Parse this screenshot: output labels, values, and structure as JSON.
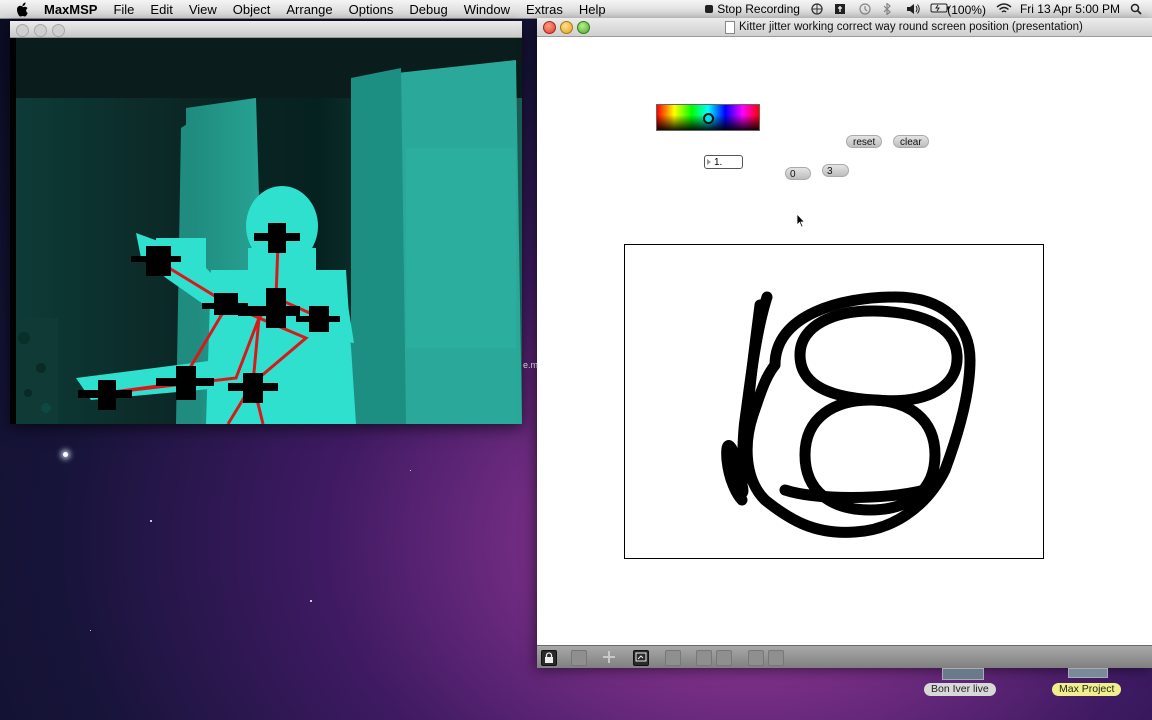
{
  "menubar": {
    "app_name": "MaxMSP",
    "items": [
      "File",
      "Edit",
      "View",
      "Object",
      "Arrange",
      "Options",
      "Debug",
      "Window",
      "Extras",
      "Help"
    ],
    "recording_label": "Stop Recording",
    "battery": "(100%)",
    "clock": "Fri 13 Apr  5:00 PM"
  },
  "left_window": {
    "title": "",
    "content": "kinect-depth-view-with-skeleton"
  },
  "right_window": {
    "title": "Kitter jitter working correct way round screen position (presentation)",
    "reset_label": "reset",
    "clear_label": "clear",
    "number_value": "1.",
    "toggle_0_value": "0",
    "toggle_3_value": "3"
  },
  "dock": {
    "item1": "Bon Iver live",
    "item2": "Max Project"
  },
  "colors": {
    "accent_cyan": "#2fe0cf",
    "skeleton_red": "#d61a1a",
    "dock_item2_bg": "#f0f08a"
  }
}
